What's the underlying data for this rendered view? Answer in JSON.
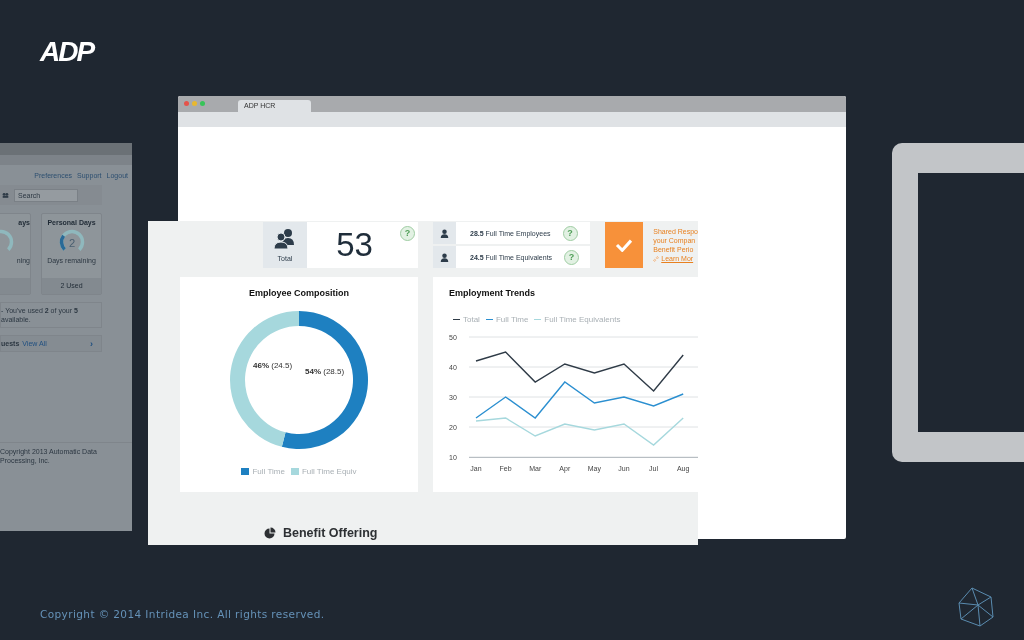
{
  "logo": "ADP",
  "back_window": {
    "links": [
      "Preferences",
      "Support",
      "Logout"
    ],
    "search": {
      "placeholder": "Search"
    },
    "cards": [
      {
        "title": "ays",
        "caption": "ning"
      },
      {
        "title": "Personal Days",
        "value": "2",
        "caption": "Days remaining",
        "footer": "2 Used",
        "level": 0.3
      }
    ],
    "notice": "- You've used **2** of your **5** available.",
    "requests": {
      "label": "uests",
      "link": "View All",
      "chevron": "›"
    },
    "copyright": "Copyright 2013 Automatic Data Processing, Inc."
  },
  "browser": {
    "tab": "ADP HCR"
  },
  "dashboard": {
    "total": {
      "label": "Total",
      "value": "53",
      "help": "?"
    },
    "counts": [
      {
        "text": "**28.5** Full Time Employees",
        "help": "?"
      },
      {
        "text": "**24.5** Full Time Equivalents",
        "help": "?"
      }
    ],
    "alert": {
      "lines": [
        "Shared Respo",
        "your Compan",
        "Benefit Perio"
      ],
      "link": "Learn Mor"
    },
    "composition": {
      "title": "Employee Composition",
      "chart_data": {
        "type": "donut",
        "categories": [
          "Full Time",
          "Full Time Equiv"
        ],
        "values": [
          54,
          46
        ],
        "value_labels": [
          "**54%** (28.5)",
          "**46%** (24.5)"
        ]
      },
      "legend": [
        {
          "color": "#1e80c1"
        },
        {
          "color": "#a6d8dd"
        }
      ]
    },
    "trends": {
      "title": "Employment Trends",
      "chart_data": {
        "type": "line",
        "categories": [
          "Jan",
          "Feb",
          "Mar",
          "Apr",
          "May",
          "Jun",
          "Jul",
          "Aug"
        ],
        "series": [
          {
            "name": "Total",
            "color": "#2f3b47",
            "values": [
              42,
              45,
              35,
              41,
              38,
              41,
              32,
              44
            ]
          },
          {
            "name": "Full Time",
            "color": "#2b8fd0",
            "values": [
              23,
              30,
              23,
              35,
              28,
              30,
              27,
              31
            ]
          },
          {
            "name": "Full Time Equivalents",
            "color": "#a6d8dd",
            "values": [
              22,
              23,
              17,
              21,
              19,
              21,
              14,
              23
            ]
          }
        ],
        "ylim": [
          10,
          50
        ],
        "yticks": [
          10,
          20,
          30,
          40,
          50
        ],
        "grid": true
      }
    },
    "section_title": "Benefit Offering"
  },
  "copyright": "Copyright © 2014 Intridea Inc. All rights reserved."
}
